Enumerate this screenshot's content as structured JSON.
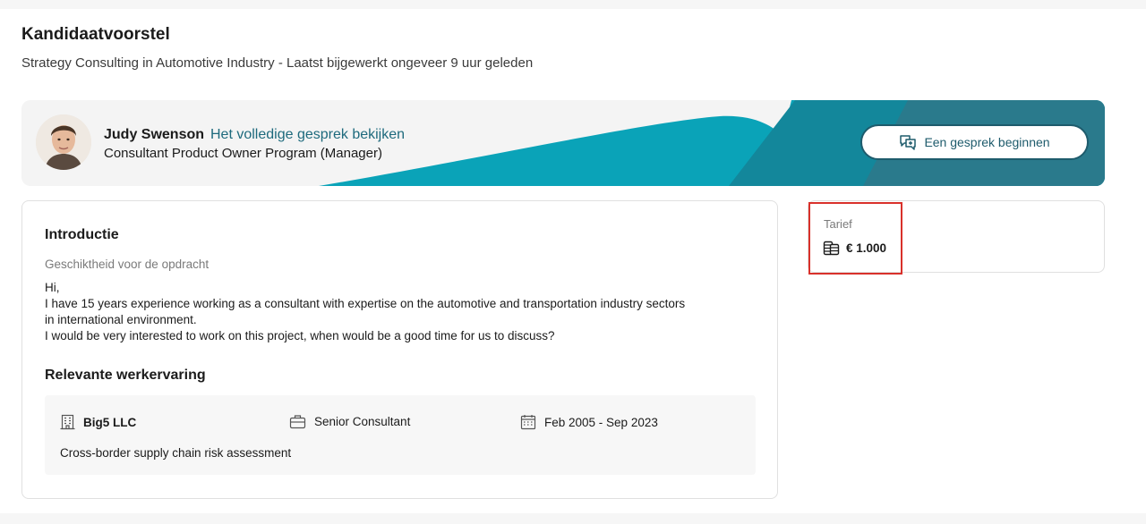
{
  "header": {
    "title": "Kandidaatvoorstel",
    "subtitle": "Strategy Consulting in Automotive Industry - Laatst bijgewerkt ongeveer 9 uur geleden"
  },
  "candidate": {
    "name": "Judy Swenson",
    "view_conversation_label": "Het volledige gesprek bekijken",
    "role": "Consultant Product Owner Program (Manager)",
    "start_conversation_label": "Een gesprek beginnen"
  },
  "intro": {
    "heading": "Introductie",
    "fit_label": "Geschiktheid voor de opdracht",
    "lines": [
      "Hi,",
      "I have 15 years experience working as a consultant with expertise on the automotive and transportation industry sectors",
      "in international environment.",
      "I would be very interested to work on this project, when would be a good time for us to discuss?"
    ]
  },
  "experience": {
    "heading": "Relevante werkervaring",
    "company": "Big5 LLC",
    "role": "Senior Consultant",
    "dates": "Feb 2005 - Sep 2023",
    "description": "Cross-border supply chain risk assessment"
  },
  "rate": {
    "label": "Tarief",
    "value": "€ 1.000"
  },
  "colors": {
    "accent": "#1e5b6c",
    "link": "#1e6a7d",
    "banner_teal": "#0aa3b8",
    "banner_dark": "#2a7a8c",
    "highlight": "#d9312b"
  }
}
